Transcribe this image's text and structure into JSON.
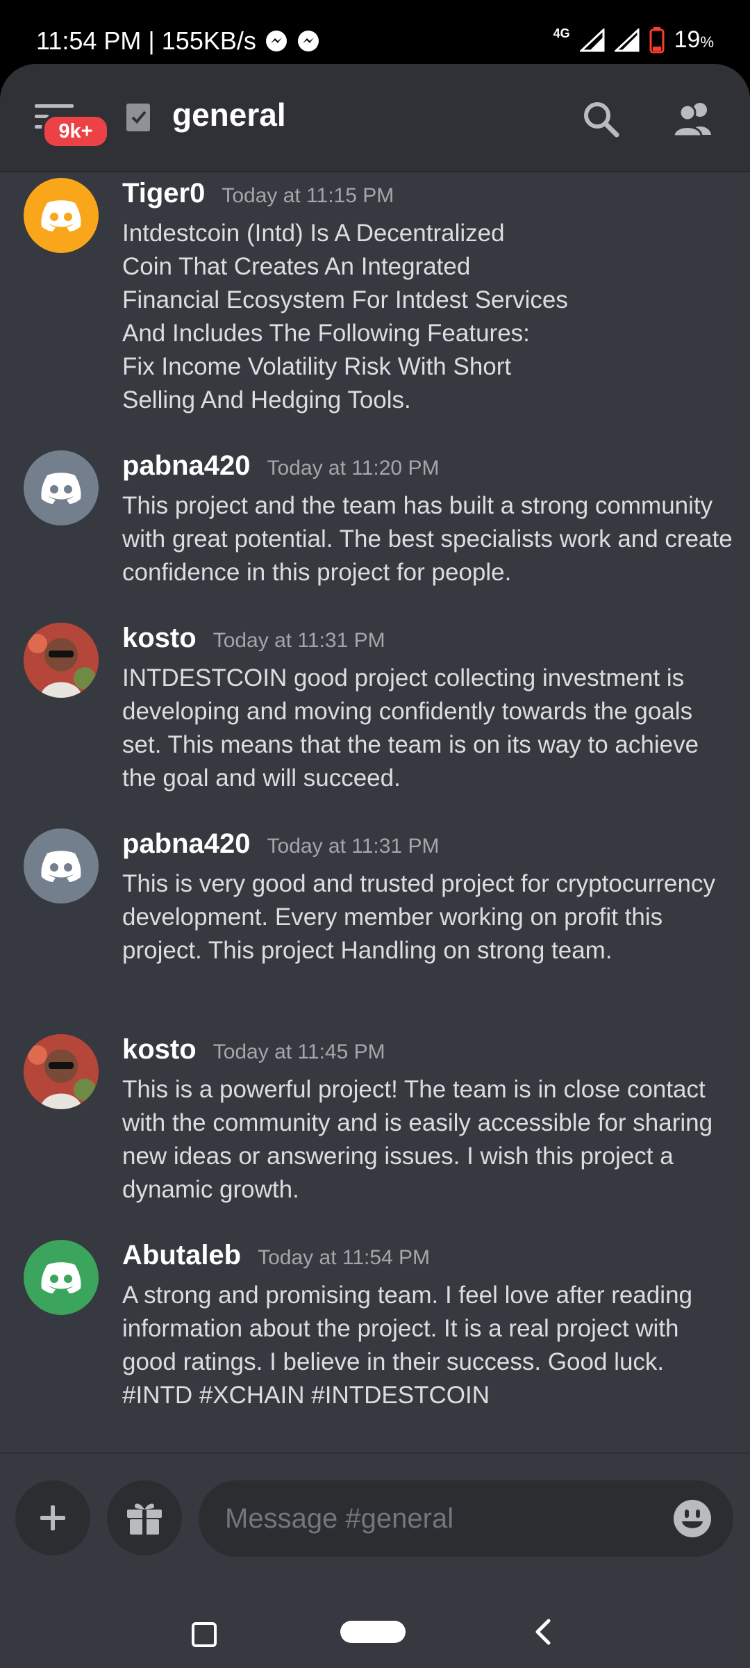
{
  "status_bar": {
    "time_speed": "11:54 PM | 155KB/s",
    "network": "4G",
    "battery": "19",
    "battery_unit": "%"
  },
  "header": {
    "badge": "9k+",
    "channel": "general",
    "icons": [
      "menu-icon",
      "channel-icon",
      "search-icon",
      "members-icon"
    ]
  },
  "messages": [
    {
      "author": "Tiger0",
      "time": "Today at 11:15 PM",
      "avatar_color": "#faa61a",
      "text": "Intdestcoin (Intd) Is A Decentralized\nCoin That Creates An Integrated\nFinancial Ecosystem For Intdest Services\nAnd Includes The Following Features:\nFix Income Volatility Risk With Short\nSelling And Hedging Tools."
    },
    {
      "author": "pabna420",
      "time": "Today at 11:20 PM",
      "avatar_color": "#747f8d",
      "text": "This project and the team has built a strong community with great potential. The best specialists work and create confidence in this project for people."
    },
    {
      "author": "kosto",
      "time": "Today at 11:31 PM",
      "avatar_color": "photo",
      "text": "INTDESTCOIN good project collecting investment is developing and moving confidently towards the goals set. This means that the team is on its way to achieve the goal and will succeed."
    },
    {
      "author": "pabna420",
      "time": "Today at 11:31 PM",
      "avatar_color": "#747f8d",
      "text": "This is very good and trusted project for cryptocurrency development. Every member working on profit this project. This project Handling on strong team."
    },
    {
      "author": "kosto",
      "time": "Today at 11:45 PM",
      "avatar_color": "photo",
      "text": "This is a powerful project! The team is in close contact with the community and is easily accessible for sharing new ideas or answering issues. I wish this project a dynamic growth."
    },
    {
      "author": "Abutaleb",
      "time": "Today at 11:54 PM",
      "avatar_color": "#3ba55d",
      "text": "A strong and promising team. I feel love after reading information about the project. It is a real project with good ratings. I believe in their success. Good luck.\n#INTD #XCHAIN  #INTDESTCOIN"
    }
  ],
  "composer": {
    "placeholder": "Message #general"
  }
}
